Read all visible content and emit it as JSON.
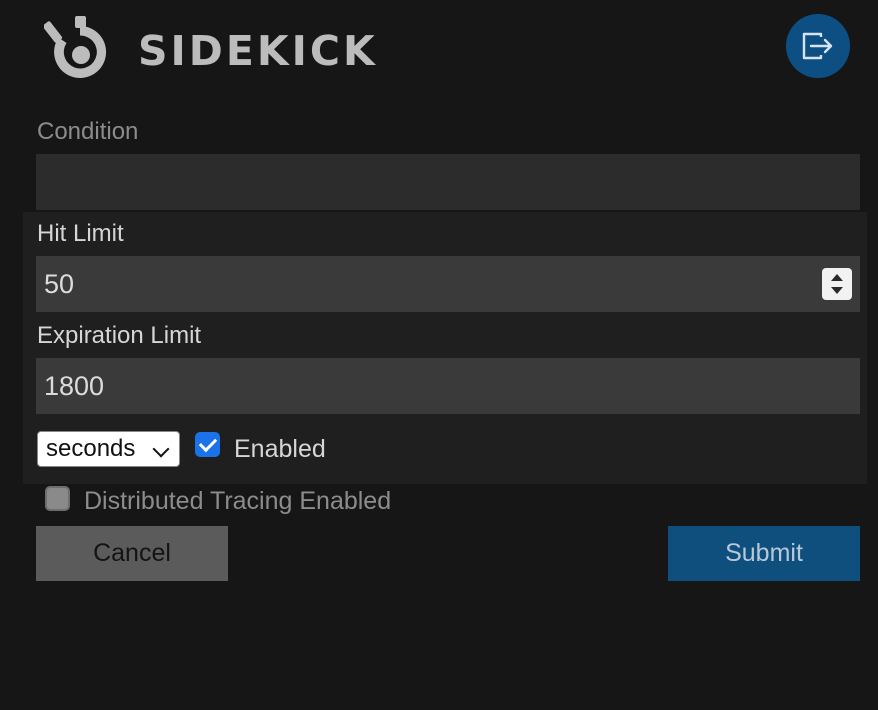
{
  "header": {
    "brand_name": "SIDEKICK",
    "logo_icon": "sidekick-logo",
    "logout_icon": "logout-icon",
    "colors": {
      "logout_button": "#0e4f83",
      "brand_text": "#bcbcbc"
    }
  },
  "form": {
    "condition": {
      "label": "Condition",
      "value": ""
    },
    "hit_limit": {
      "label": "Hit Limit",
      "value": "50"
    },
    "expiration_limit": {
      "label": "Expiration Limit",
      "value": "1800"
    },
    "time_unit": {
      "selected": "seconds"
    },
    "enabled": {
      "label": "Enabled",
      "checked": true
    },
    "distributed_tracing": {
      "label": "Distributed Tracing Enabled",
      "checked": false
    }
  },
  "actions": {
    "cancel_label": "Cancel",
    "submit_label": "Submit",
    "colors": {
      "cancel": "#5b5b5b",
      "submit": "#0e4f7e",
      "checkbox_checked": "#1a73e8"
    }
  }
}
